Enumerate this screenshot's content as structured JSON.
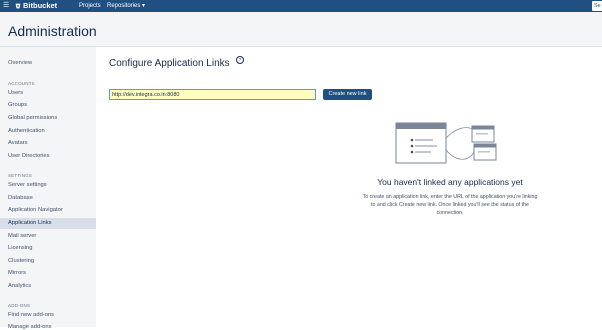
{
  "topbar": {
    "logo_text": "Bitbucket",
    "nav": [
      {
        "label": "Projects"
      },
      {
        "label": "Repositories ▾"
      }
    ],
    "search_stub": "Se"
  },
  "header": {
    "title": "Administration"
  },
  "sidebar": {
    "overview": "Overview",
    "sections": [
      {
        "heading": "ACCOUNTS",
        "items": [
          "Users",
          "Groups",
          "Global permissions",
          "Authentication",
          "Avatars",
          "User Directories"
        ]
      },
      {
        "heading": "SETTINGS",
        "items": [
          "Server settings",
          "Database",
          "Application Navigator",
          "Application Links",
          "Mail server",
          "Licensing",
          "Clustering",
          "Mirrors",
          "Analytics"
        ]
      },
      {
        "heading": "ADD-ONS",
        "items": [
          "Find new add-ons",
          "Manage add-ons"
        ]
      }
    ],
    "active_item": "Application Links"
  },
  "main": {
    "title": "Configure Application Links",
    "help_glyph": "?",
    "url_input_value": "http://dev.integra.co.in:8080",
    "create_button_label": "Create new link",
    "empty_state": {
      "title": "You haven't linked any applications yet",
      "description": "To create an application link, enter the URL of the application you're linking to and click Create new link. Once linked you'll see the status of the connection."
    }
  },
  "colors": {
    "topbar": "#205081",
    "sidebar_bg": "#f4f5f7",
    "active_item_bg": "#d8dee8",
    "button_bg": "#205081",
    "input_bg": "#ffffbf",
    "input_border": "#4c9aff"
  }
}
